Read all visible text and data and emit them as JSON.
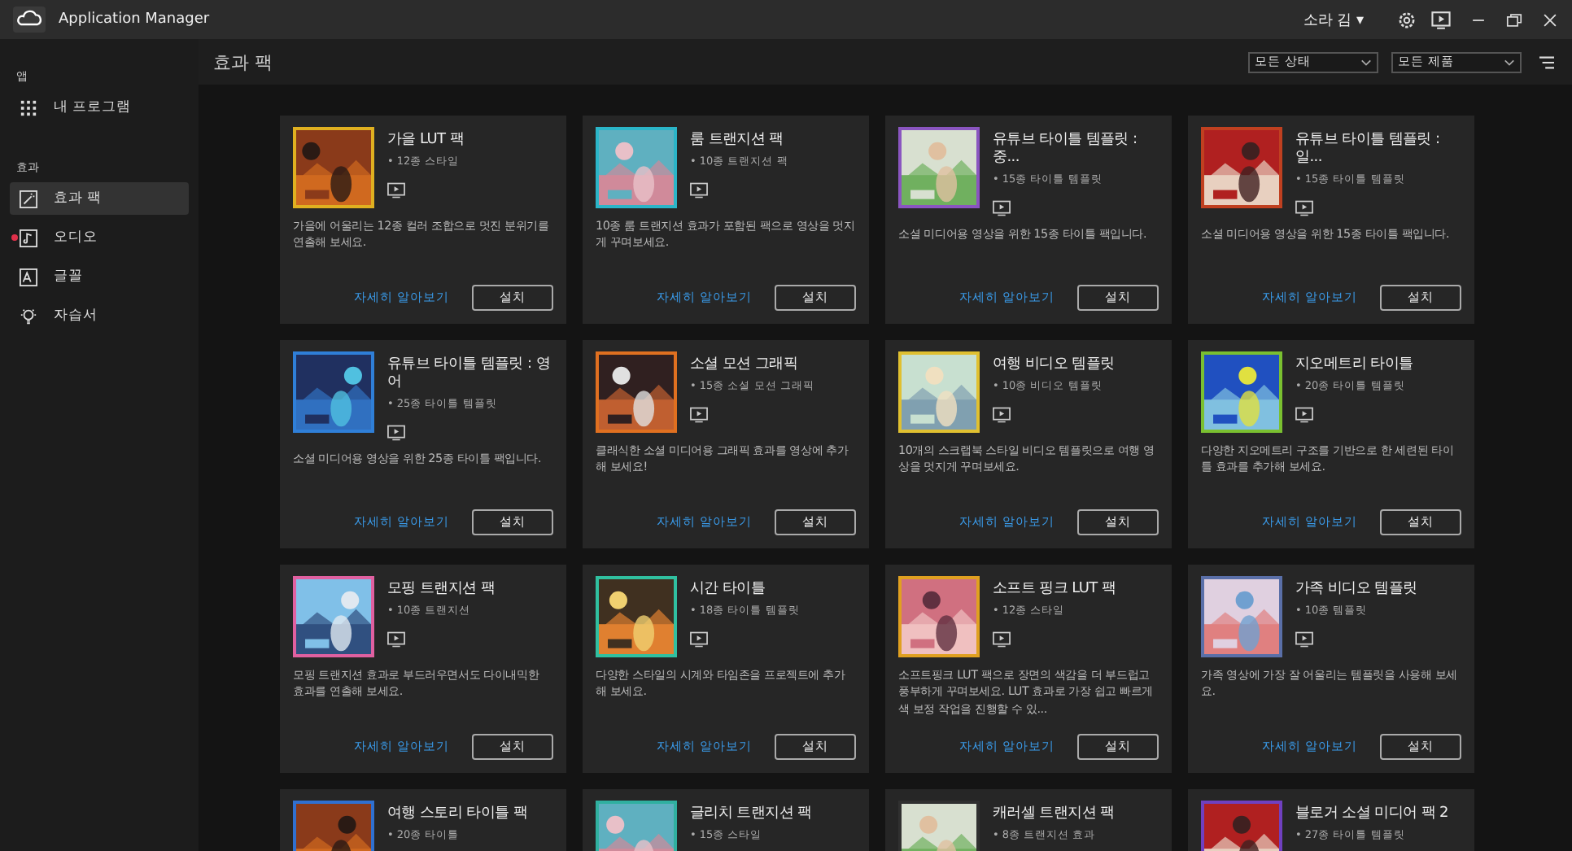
{
  "app": {
    "title": "Application Manager",
    "user": "소라 김 ▾"
  },
  "sidebar": {
    "sections": [
      {
        "header": "앱",
        "items": [
          {
            "label": "내 프로그램",
            "kind": "grid",
            "selected": false,
            "new": false
          }
        ]
      },
      {
        "header": "효과",
        "items": [
          {
            "label": "효과 팩",
            "kind": "wand",
            "selected": true,
            "new": false
          },
          {
            "label": "오디오",
            "kind": "audio",
            "selected": false,
            "new": true
          },
          {
            "label": "글꼴",
            "kind": "font",
            "selected": false,
            "new": false
          },
          {
            "label": "자습서",
            "kind": "bulb",
            "selected": false,
            "new": false
          }
        ]
      }
    ]
  },
  "page": {
    "title": "효과 팩",
    "filters": [
      "모든 상태",
      "모든 제품"
    ]
  },
  "cards": [
    {
      "title": "가을 LUT 팩",
      "subtitle": "• 12종 스타일",
      "color": "#e0b020",
      "description": "가을에 어울리는 12종 컬러 조합으로 멋진 분위기를 연출해 보세요.",
      "link": "자세히 알아보기",
      "button": "설치"
    },
    {
      "title": "룸 트랜지션 팩",
      "subtitle": "• 10종 트랜지션 팩",
      "color": "#2bb5c8",
      "description": "10종 룸 트랜지션 효과가 포함된 팩으로 영상을 멋지게 꾸며보세요.",
      "link": "자세히 알아보기",
      "button": "설치"
    },
    {
      "title": "유튜브 타이틀 템플릿 : 중...",
      "subtitle": "• 15종 타이틀 템플릿",
      "color": "#8a55c0",
      "description": "소셜 미디어용 영상을 위한 15종 타이틀 팩입니다.",
      "link": "자세히 알아보기",
      "button": "설치"
    },
    {
      "title": "유튜브 타이틀 템플릿 : 일...",
      "subtitle": "• 15종 타이틀 템플릿",
      "color": "#c04020",
      "description": "소셜 미디어용 영상을 위한 15종 타이틀 팩입니다.",
      "link": "자세히 알아보기",
      "button": "설치"
    },
    {
      "title": "유튜브 타이틀 템플릿 : 영어",
      "subtitle": "• 25종 타이틀 템플릿",
      "color": "#2f7fd8",
      "description": "소셜 미디어용 영상을 위한 25종 타이틀 팩입니다.",
      "link": "자세히 알아보기",
      "button": "설치"
    },
    {
      "title": "소셜 모션 그래픽",
      "subtitle": "• 15종 소셜 모션 그래픽",
      "color": "#e07020",
      "description": "클래식한 소셜 미디어용 그래픽 효과를 영상에 추가해 보세요!",
      "link": "자세히 알아보기",
      "button": "설치"
    },
    {
      "title": "여행 비디오 템플릿",
      "subtitle": "• 10종 비디오 템플릿",
      "color": "#e0c030",
      "description": "10개의 스크랩북 스타일 비디오 템플릿으로 여행 영상을 멋지게 꾸며보세요.",
      "link": "자세히 알아보기",
      "button": "설치"
    },
    {
      "title": "지오메트리 타이틀",
      "subtitle": "• 20종 타이틀 템플릿",
      "color": "#7ac030",
      "description": "다양한 지오메트리 구조를 기반으로 한 세련된 타이틀 효과를 추가해 보세요.",
      "link": "자세히 알아보기",
      "button": "설치"
    },
    {
      "title": "모핑 트랜지션 팩",
      "subtitle": "• 10종 트랜지션",
      "color": "#e060a0",
      "description": "모핑 트랜지션 효과로 부드러우면서도 다이내믹한 효과를 연출해 보세요.",
      "link": "자세히 알아보기",
      "button": "설치"
    },
    {
      "title": "시간 타이틀",
      "subtitle": "• 18종 타이틀 템플릿",
      "color": "#30c0a0",
      "description": "다양한 스타일의 시계와 타임존을 프로젝트에 추가해 보세요.",
      "link": "자세히 알아보기",
      "button": "설치"
    },
    {
      "title": "소프트 핑크 LUT 팩",
      "subtitle": "• 12종 스타일",
      "color": "#e0a020",
      "description": "소프트핑크 LUT 팩으로 장면의 색감을 더 부드럽고 풍부하게 꾸며보세요. LUT 효과로 가장 쉽고 빠르게 색 보정 작업을 진행할 수 있...",
      "link": "자세히 알아보기",
      "button": "설치"
    },
    {
      "title": "가족 비디오 템플릿",
      "subtitle": "• 10종 템플릿",
      "color": "#5a6fa8",
      "description": "가족 영상에 가장 잘 어울리는 템플릿을 사용해 보세요.",
      "link": "자세히 알아보기",
      "button": "설치"
    },
    {
      "title": "여행 스토리 타이틀 팩",
      "subtitle": "• 20종 타이틀",
      "color": "#3070d0"
    },
    {
      "title": "글리치 트랜지션 팩",
      "subtitle": "• 15종 스타일",
      "color": "#30b0a0"
    },
    {
      "title": "캐러셀 트랜지션 팩",
      "subtitle": "• 8종 트랜지션 효과",
      "color": "#303030"
    },
    {
      "title": "블로거 소셜 미디어 팩 2",
      "subtitle": "• 27종 타이틀 템플릿",
      "color": "#7040c0"
    }
  ]
}
